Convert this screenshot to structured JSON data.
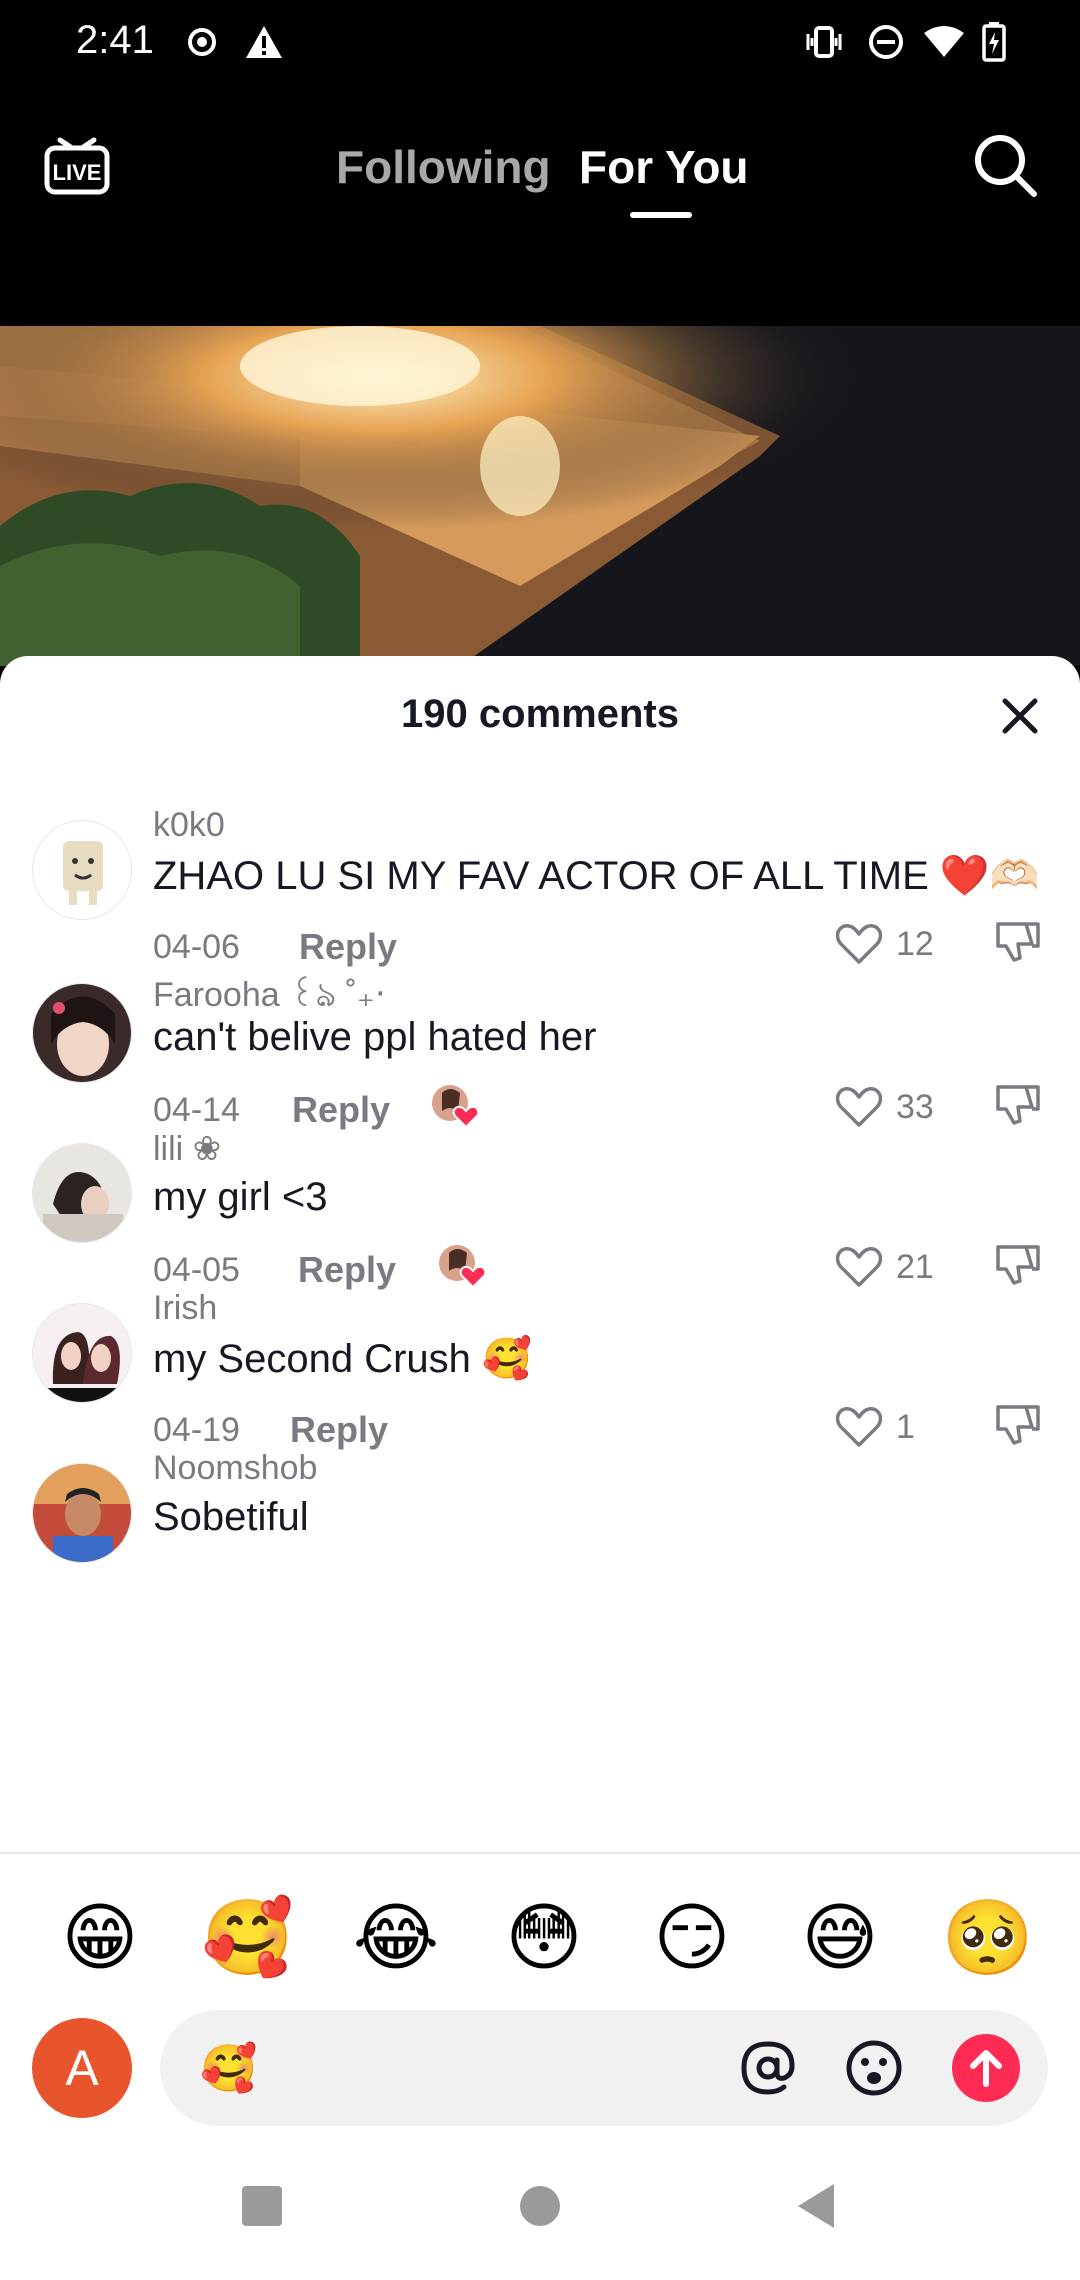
{
  "status_bar": {
    "time": "2:41"
  },
  "nav": {
    "live_label": "LIVE",
    "tabs": [
      {
        "label": "Following",
        "active": false
      },
      {
        "label": "For You",
        "active": true
      }
    ]
  },
  "comments_sheet": {
    "title": "190 comments",
    "reply_label": "Reply",
    "comments": [
      {
        "username": "k0k0",
        "text": "ZHAO LU SI MY FAV ACTOR OF ALL TIME ❤️🫶🏻",
        "date": "04-06",
        "likes": "12",
        "liked_by_creator": false
      },
      {
        "username": "Farooha ꒰ঌ ˚₊‧",
        "text": "can't belive ppl hated her",
        "date": "04-14",
        "likes": "33",
        "liked_by_creator": true
      },
      {
        "username": "lili ❀",
        "text": "my girl <3",
        "date": "04-05",
        "likes": "21",
        "liked_by_creator": true
      },
      {
        "username": "Irish",
        "text": "my Second Crush 🥰",
        "date": "04-19",
        "likes": "1",
        "liked_by_creator": false
      },
      {
        "username": "Noomshob",
        "text": "Sobetiful",
        "date": "",
        "likes": "",
        "liked_by_creator": false
      }
    ]
  },
  "quick_emojis": [
    "😁",
    "🥰",
    "😂",
    "😳",
    "😏",
    "😅",
    "🥺"
  ],
  "composer": {
    "user_initial": "A",
    "value": "🥰"
  },
  "colors": {
    "accent": "#fe2c55",
    "my_avatar": "#e8542b"
  }
}
